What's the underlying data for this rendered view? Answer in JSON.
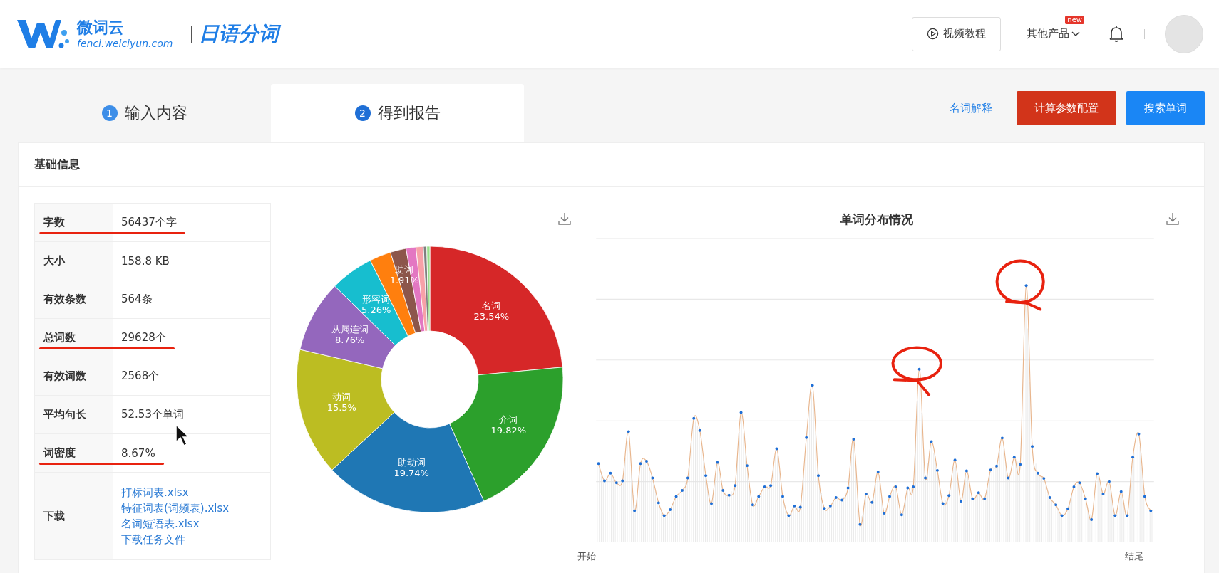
{
  "header": {
    "brand_name": "微词云",
    "brand_url": "fenci.weiciyun.com",
    "product_title": "日语分词",
    "video_button": "视频教程",
    "products_menu": {
      "label": "其他产品",
      "badge": "new"
    }
  },
  "steps": [
    {
      "number": "1",
      "label": "输入内容",
      "selected": false
    },
    {
      "number": "2",
      "label": "得到报告",
      "selected": true
    }
  ],
  "actions": [
    {
      "kind": "link",
      "label": "名词解释"
    },
    {
      "kind": "danger",
      "label": "计算参数配置"
    },
    {
      "kind": "primary",
      "label": "搜索单词"
    }
  ],
  "basic_info": {
    "title": "基础信息",
    "rows": [
      {
        "label": "字数",
        "value": "56437个字",
        "underlined": true
      },
      {
        "label": "大小",
        "value": "158.8 KB",
        "underlined": false
      },
      {
        "label": "有效条数",
        "value": "564条",
        "underlined": false
      },
      {
        "label": "总词数",
        "value": "29628个",
        "underlined": true
      },
      {
        "label": "有效词数",
        "value": "2568个",
        "underlined": false
      },
      {
        "label": "平均句长",
        "value": "52.53个单词",
        "underlined": false
      },
      {
        "label": "词密度",
        "value": "8.67%",
        "underlined": true
      },
      {
        "label": "下载",
        "links": [
          "打标词表.xlsx",
          "特征词表(词频表).xlsx",
          "名词短语表.xlsx",
          "下载任务文件"
        ],
        "underlined": false
      }
    ]
  },
  "pie_chart": {
    "chart_data": {
      "type": "donut",
      "categories": [
        "名词",
        "介词",
        "助动词",
        "动词",
        "从属连词",
        "形容词",
        null,
        "助词",
        null,
        null,
        null,
        null
      ],
      "values": [
        23.54,
        19.82,
        19.74,
        15.5,
        8.76,
        5.26,
        2.6,
        1.91,
        1.2,
        0.9,
        0.4,
        0.37
      ],
      "colors": [
        "#d62728",
        "#2ca02c",
        "#1f77b4",
        "#bcbd22",
        "#9467bd",
        "#17becf",
        "#ff7f0e",
        "#8c564b",
        "#e377c2",
        "#f7a1a8",
        "#7f7f7f",
        "#98df8a"
      ],
      "value_labels": [
        "23.54%",
        "19.82%",
        "19.74%",
        "15.5%",
        "8.76%",
        "5.26%",
        null,
        "1.91%",
        null,
        null,
        null,
        null
      ],
      "data_labels": true
    }
  },
  "distribution_chart": {
    "title": "单词分布情况",
    "x_start": "开始",
    "x_end": "结尾",
    "annotations": [
      {
        "kind": "circle"
      },
      {
        "kind": "circle"
      }
    ]
  }
}
